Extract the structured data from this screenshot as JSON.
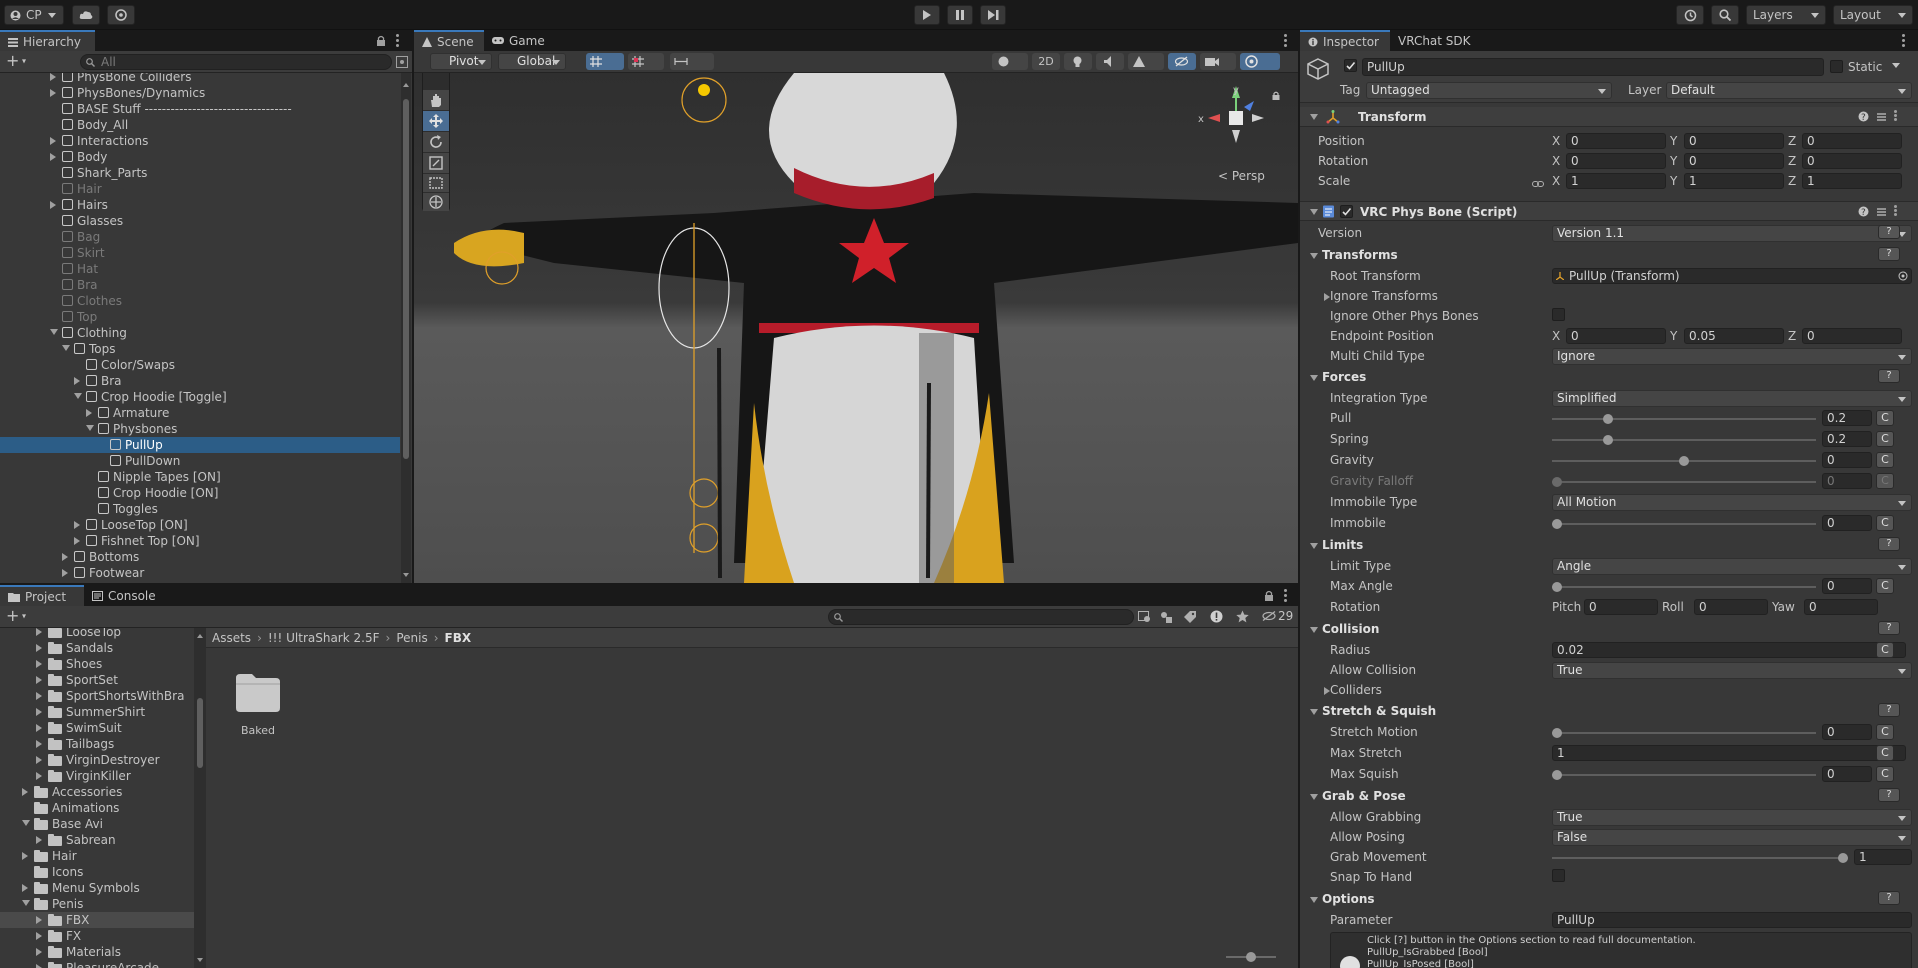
{
  "toolbar": {
    "account": "CP",
    "layers": "Layers",
    "layout": "Layout"
  },
  "hierarchy": {
    "tab": "Hierarchy",
    "search_placeholder": "All",
    "items": [
      {
        "label": "PhysBone Colliders",
        "depth": 0,
        "arrow": "right",
        "dim": false
      },
      {
        "label": "PhysBones/Dynamics",
        "depth": 0,
        "arrow": "right",
        "dim": false
      },
      {
        "label": "BASE Stuff ----------------------------------",
        "depth": 0,
        "arrow": "none",
        "dim": false
      },
      {
        "label": "Body_All",
        "depth": 0,
        "arrow": "none",
        "dim": false
      },
      {
        "label": "Interactions",
        "depth": 0,
        "arrow": "right",
        "dim": false
      },
      {
        "label": "Body",
        "depth": 0,
        "arrow": "right",
        "dim": false
      },
      {
        "label": "Shark_Parts",
        "depth": 0,
        "arrow": "none",
        "dim": false
      },
      {
        "label": "Hair",
        "depth": 0,
        "arrow": "none",
        "dim": true
      },
      {
        "label": "Hairs",
        "depth": 0,
        "arrow": "right",
        "dim": false
      },
      {
        "label": "Glasses",
        "depth": 0,
        "arrow": "none",
        "dim": false
      },
      {
        "label": "Bag",
        "depth": 0,
        "arrow": "none",
        "dim": true
      },
      {
        "label": "Skirt",
        "depth": 0,
        "arrow": "none",
        "dim": true
      },
      {
        "label": "Hat",
        "depth": 0,
        "arrow": "none",
        "dim": true
      },
      {
        "label": "Bra",
        "depth": 0,
        "arrow": "none",
        "dim": true
      },
      {
        "label": "Clothes",
        "depth": 0,
        "arrow": "none",
        "dim": true
      },
      {
        "label": "Top",
        "depth": 0,
        "arrow": "none",
        "dim": true
      },
      {
        "label": "Clothing",
        "depth": 0,
        "arrow": "down",
        "dim": false
      },
      {
        "label": "Tops",
        "depth": 1,
        "arrow": "down",
        "dim": false
      },
      {
        "label": "Color/Swaps",
        "depth": 2,
        "arrow": "none",
        "dim": false
      },
      {
        "label": "Bra",
        "depth": 2,
        "arrow": "right",
        "dim": false
      },
      {
        "label": "Crop Hoodie [Toggle]",
        "depth": 2,
        "arrow": "down",
        "dim": false
      },
      {
        "label": "Armature",
        "depth": 3,
        "arrow": "right",
        "dim": false
      },
      {
        "label": "Physbones",
        "depth": 3,
        "arrow": "down",
        "dim": false
      },
      {
        "label": "PullUp",
        "depth": 4,
        "arrow": "none",
        "dim": false,
        "selected": true
      },
      {
        "label": "PullDown",
        "depth": 4,
        "arrow": "none",
        "dim": false
      },
      {
        "label": "Nipple Tapes [ON]",
        "depth": 3,
        "arrow": "none",
        "dim": false
      },
      {
        "label": "Crop Hoodie [ON]",
        "depth": 3,
        "arrow": "none",
        "dim": false
      },
      {
        "label": "Toggles",
        "depth": 3,
        "arrow": "none",
        "dim": false
      },
      {
        "label": "LooseTop [ON]",
        "depth": 2,
        "arrow": "right",
        "dim": false
      },
      {
        "label": "Fishnet Top [ON]",
        "depth": 2,
        "arrow": "right",
        "dim": false
      },
      {
        "label": "Bottoms",
        "depth": 1,
        "arrow": "right",
        "dim": false
      },
      {
        "label": "Footwear",
        "depth": 1,
        "arrow": "right",
        "dim": false
      }
    ]
  },
  "scene": {
    "tabs": [
      "Scene",
      "Game"
    ],
    "pivot": "Pivot",
    "global": "Global",
    "mode_2d": "2D",
    "persp": "Persp",
    "axis_x": "x",
    "axis_y": "y"
  },
  "project": {
    "tabs": [
      "Project",
      "Console"
    ],
    "hidden_count": "29",
    "breadcrumb": [
      "Assets",
      "!!! UltraShark 2.5F",
      "Penis",
      "FBX"
    ],
    "folders": [
      {
        "label": "LooseTop",
        "depth": 1,
        "arrow": "right"
      },
      {
        "label": "Sandals",
        "depth": 1,
        "arrow": "right"
      },
      {
        "label": "Shoes",
        "depth": 1,
        "arrow": "right"
      },
      {
        "label": "SportSet",
        "depth": 1,
        "arrow": "right"
      },
      {
        "label": "SportShortsWithBra",
        "depth": 1,
        "arrow": "right"
      },
      {
        "label": "SummerShirt",
        "depth": 1,
        "arrow": "right"
      },
      {
        "label": "SwimSuit",
        "depth": 1,
        "arrow": "right"
      },
      {
        "label": "Tailbags",
        "depth": 1,
        "arrow": "right"
      },
      {
        "label": "VirginDestroyer",
        "depth": 1,
        "arrow": "right"
      },
      {
        "label": "VirginKiller",
        "depth": 1,
        "arrow": "right"
      },
      {
        "label": "Accessories",
        "depth": 0,
        "arrow": "right"
      },
      {
        "label": "Animations",
        "depth": 0,
        "arrow": "none"
      },
      {
        "label": "Base Avi",
        "depth": 0,
        "arrow": "down"
      },
      {
        "label": "Sabrean",
        "depth": 1,
        "arrow": "right"
      },
      {
        "label": "Hair",
        "depth": 0,
        "arrow": "right"
      },
      {
        "label": "Icons",
        "depth": 0,
        "arrow": "none"
      },
      {
        "label": "Menu Symbols",
        "depth": 0,
        "arrow": "right"
      },
      {
        "label": "Penis",
        "depth": 0,
        "arrow": "down"
      },
      {
        "label": "FBX",
        "depth": 1,
        "arrow": "right",
        "selected": true
      },
      {
        "label": "FX",
        "depth": 1,
        "arrow": "right"
      },
      {
        "label": "Materials",
        "depth": 1,
        "arrow": "right"
      },
      {
        "label": "PleasureArcade",
        "depth": 1,
        "arrow": "right"
      }
    ],
    "assets": [
      {
        "label": "Baked"
      }
    ]
  },
  "inspector": {
    "tabs": [
      "Inspector",
      "VRChat SDK"
    ],
    "object_name": "PullUp",
    "static_label": "Static",
    "tag_label": "Tag",
    "tag_value": "Untagged",
    "layer_label": "Layer",
    "layer_value": "Default",
    "transform": {
      "title": "Transform",
      "position_label": "Position",
      "rotation_label": "Rotation",
      "scale_label": "Scale",
      "position": [
        "0",
        "0",
        "0"
      ],
      "rotation": [
        "0",
        "0",
        "0"
      ],
      "scale": [
        "1",
        "1",
        "1"
      ],
      "axes": [
        "X",
        "Y",
        "Z"
      ]
    },
    "physbone": {
      "title": "VRC Phys Bone (Script)",
      "version_label": "Version",
      "version_value": "Version 1.1",
      "transforms_section": "Transforms",
      "root_transform_label": "Root Transform",
      "root_transform_value": "PullUp (Transform)",
      "ignore_transforms_label": "Ignore Transforms",
      "ignore_other_label": "Ignore Other Phys Bones",
      "endpoint_label": "Endpoint Position",
      "endpoint": [
        "0",
        "0.05",
        "0"
      ],
      "multichild_label": "Multi Child Type",
      "multichild_value": "Ignore",
      "forces_section": "Forces",
      "integration_label": "Integration Type",
      "integration_value": "Simplified",
      "pull_label": "Pull",
      "pull_value": "0.2",
      "pull_level": 0.2,
      "spring_label": "Spring",
      "spring_value": "0.2",
      "spring_level": 0.2,
      "gravity_label": "Gravity",
      "gravity_value": "0",
      "gravity_level": 0.5,
      "gravity_falloff_label": "Gravity Falloff",
      "gravity_falloff_value": "0",
      "immobile_type_label": "Immobile Type",
      "immobile_type_value": "All Motion",
      "immobile_label": "Immobile",
      "immobile_value": "0",
      "limits_section": "Limits",
      "limit_type_label": "Limit Type",
      "limit_type_value": "Angle",
      "max_angle_label": "Max Angle",
      "max_angle_value": "0",
      "rotation_label": "Rotation",
      "pitch_label": "Pitch",
      "pitch": "0",
      "roll_label": "Roll",
      "roll": "0",
      "yaw_label": "Yaw",
      "yaw": "0",
      "collision_section": "Collision",
      "radius_label": "Radius",
      "radius_value": "0.02",
      "allow_collision_label": "Allow Collision",
      "allow_collision_value": "True",
      "colliders_label": "Colliders",
      "stretch_section": "Stretch & Squish",
      "stretch_motion_label": "Stretch Motion",
      "stretch_motion_value": "0",
      "max_stretch_label": "Max Stretch",
      "max_stretch_value": "1",
      "max_squish_label": "Max Squish",
      "max_squish_value": "0",
      "grab_section": "Grab & Pose",
      "allow_grabbing_label": "Allow Grabbing",
      "allow_grabbing_value": "True",
      "allow_posing_label": "Allow Posing",
      "allow_posing_value": "False",
      "grab_movement_label": "Grab Movement",
      "grab_movement_value": "1",
      "grab_movement_level": 1,
      "snap_label": "Snap To Hand",
      "options_section": "Options",
      "parameter_label": "Parameter",
      "parameter_value": "PullUp",
      "help_text": "Click [?] button in the Options section to read full documentation.",
      "help_lines": [
        "PullUp_IsGrabbed [Bool]",
        "PullUp_IsPosed [Bool]"
      ],
      "c_label": "C",
      "q_label": "?"
    }
  },
  "colors": {
    "selected": "#2c5d87",
    "accent": "#3a79bb"
  }
}
